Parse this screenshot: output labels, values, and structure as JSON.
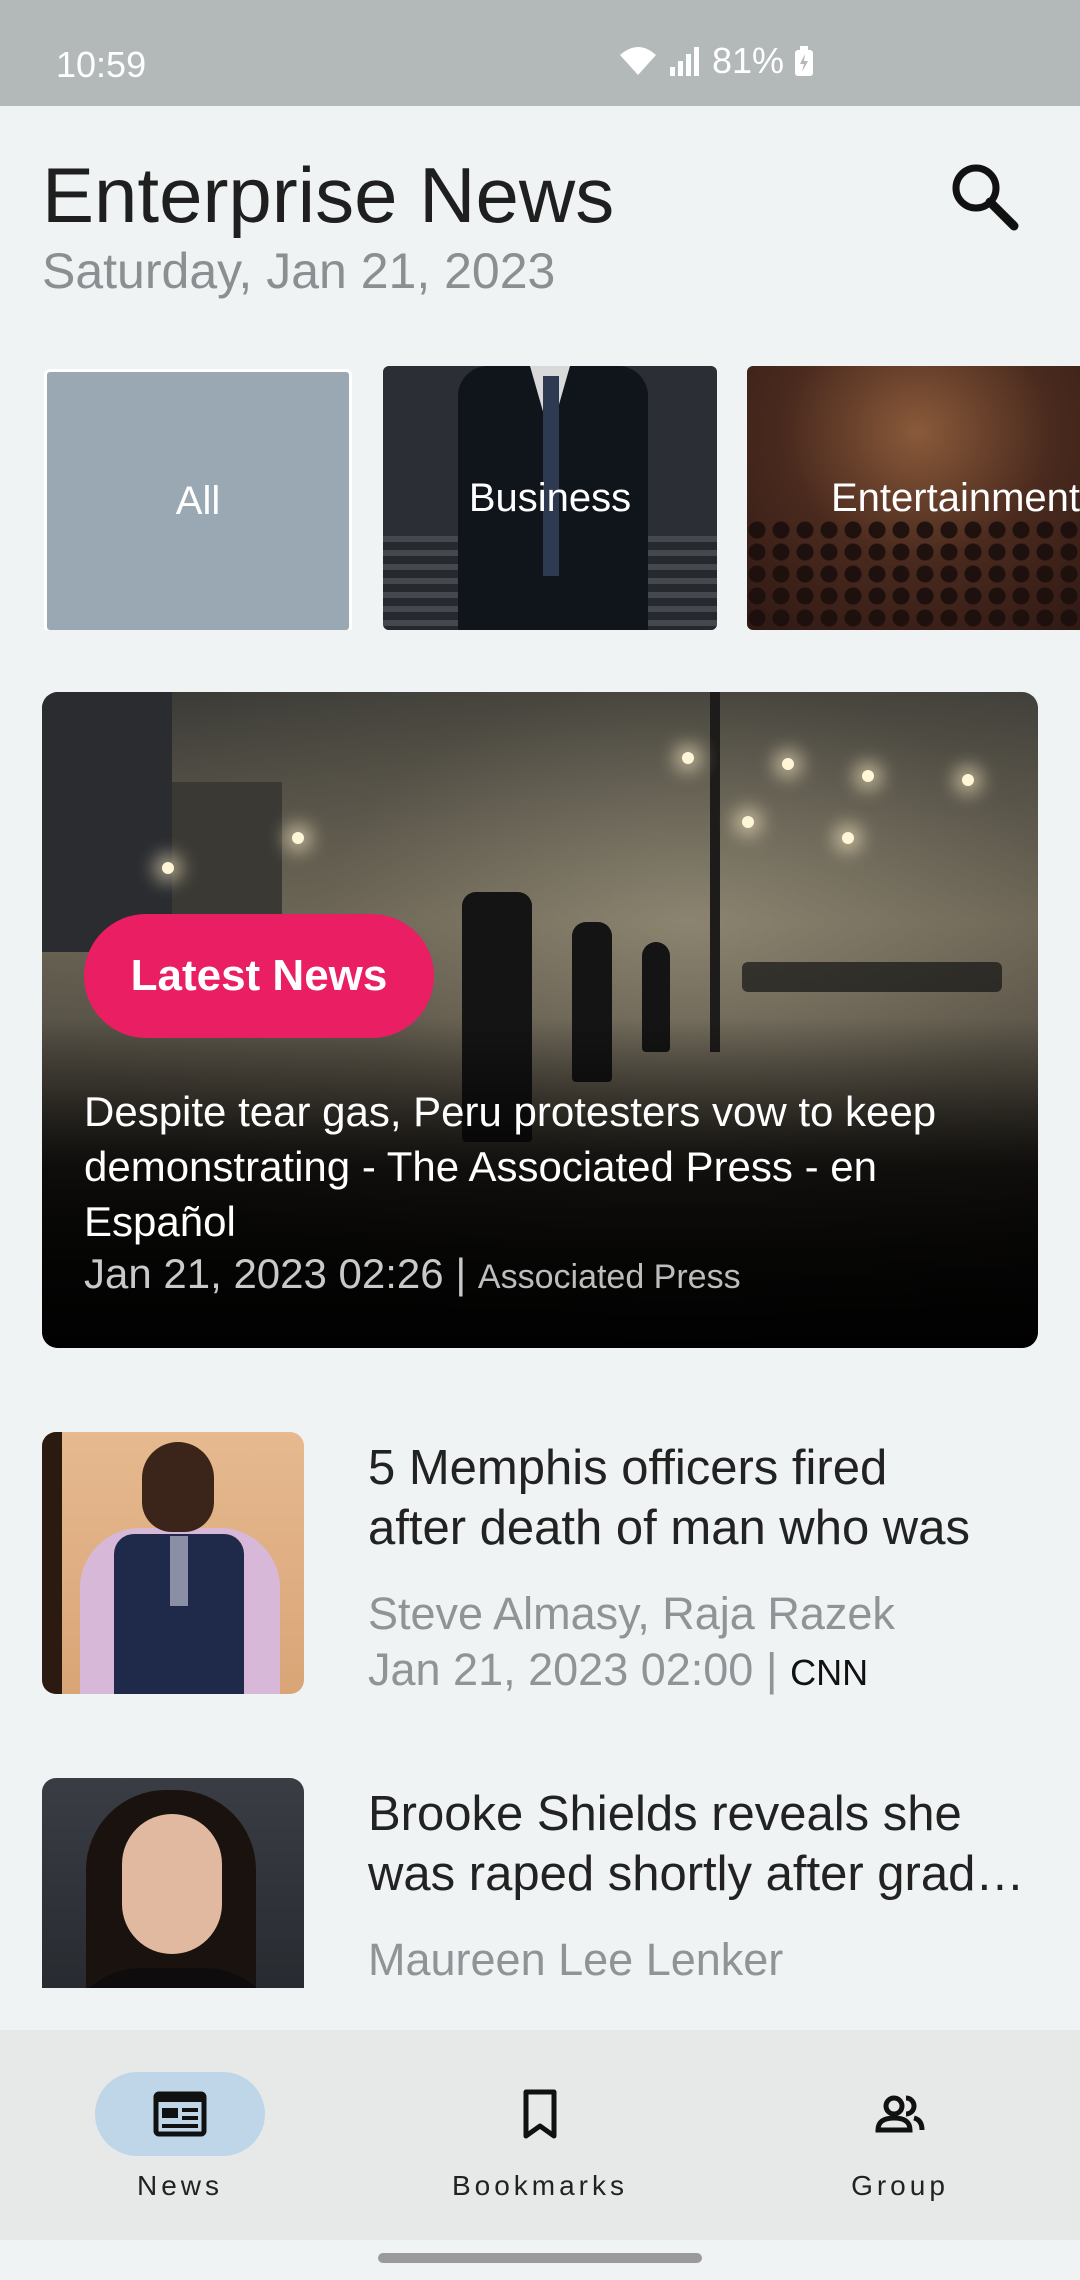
{
  "status": {
    "time": "10:59",
    "battery": "81%"
  },
  "header": {
    "title": "Enterprise News",
    "date": "Saturday, Jan 21, 2023"
  },
  "categories": [
    {
      "label": "All"
    },
    {
      "label": "Business"
    },
    {
      "label": "Entertainment"
    }
  ],
  "featured": {
    "badge": "Latest News",
    "title": "Despite tear gas, Peru protesters vow to keep demonstrating - The Associated Press - en Español",
    "date": "Jan 21, 2023 02:26",
    "separator": "|",
    "source": "Associated Press"
  },
  "articles": [
    {
      "title_line1": "5 Memphis officers fired",
      "title_line2": "after death of man who was",
      "author": "Steve Almasy, Raja Razek",
      "date": "Jan 21, 2023 02:00",
      "separator": "|",
      "source": "CNN"
    },
    {
      "title_line1": "Brooke Shields reveals she",
      "title_line2": "was raped shortly after graduating",
      "author": "Maureen Lee Lenker"
    }
  ],
  "nav": {
    "items": [
      {
        "label": "News",
        "icon": "newspaper-icon",
        "active": true
      },
      {
        "label": "Bookmarks",
        "icon": "bookmark-icon",
        "active": false
      },
      {
        "label": "Group",
        "icon": "group-icon",
        "active": false
      }
    ]
  },
  "colors": {
    "accent": "#e91e63",
    "nav_active": "#bfd6e8",
    "background": "#eff3f3"
  }
}
